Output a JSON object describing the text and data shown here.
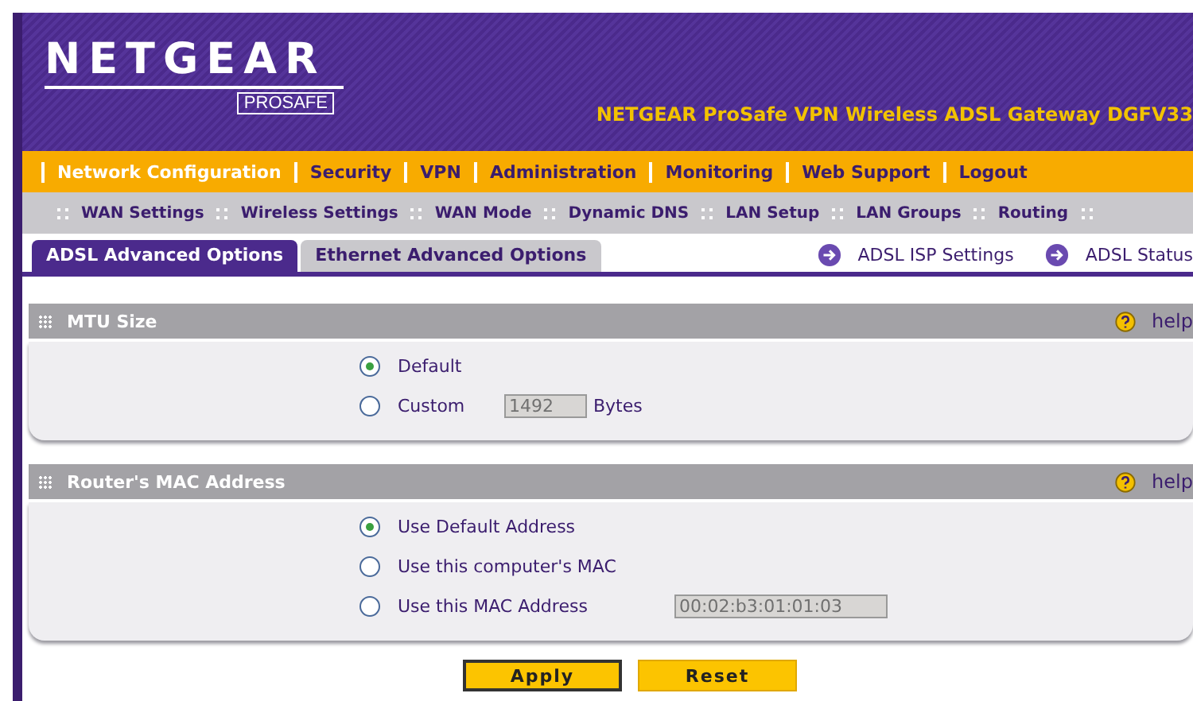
{
  "logo": {
    "brand": "NETGEAR",
    "sub": "PROSAFE"
  },
  "product_title": "NETGEAR ProSafe VPN Wireless ADSL Gateway DGFV33",
  "main_menu": [
    {
      "label": "Network Configuration",
      "selected": true
    },
    {
      "label": "Security",
      "selected": false
    },
    {
      "label": "VPN",
      "selected": false
    },
    {
      "label": "Administration",
      "selected": false
    },
    {
      "label": "Monitoring",
      "selected": false
    },
    {
      "label": "Web Support",
      "selected": false
    },
    {
      "label": "Logout",
      "selected": false
    }
  ],
  "sub_menu": [
    "WAN Settings",
    "Wireless Settings",
    "WAN Mode",
    "Dynamic DNS",
    "LAN Setup",
    "LAN Groups",
    "Routing"
  ],
  "tabs": [
    {
      "label": "ADSL Advanced Options",
      "selected": true
    },
    {
      "label": "Ethernet Advanced Options",
      "selected": false
    }
  ],
  "links": [
    "ADSL ISP Settings",
    "ADSL Status"
  ],
  "sections": [
    {
      "title": "MTU Size",
      "help": "help",
      "options": [
        {
          "label": "Default",
          "selected": true
        },
        {
          "label": "Custom",
          "selected": false,
          "field": {
            "value": "1492",
            "disabled": true
          },
          "unit": "Bytes"
        }
      ]
    },
    {
      "title": "Router's MAC Address",
      "help": "help",
      "options": [
        {
          "label": "Use Default Address",
          "selected": true
        },
        {
          "label": "Use this computer's MAC",
          "selected": false
        },
        {
          "label": "Use this MAC Address",
          "selected": false,
          "field": {
            "value": "00:02:b3:01:01:03",
            "disabled": true
          }
        }
      ]
    }
  ],
  "buttons": [
    "Apply",
    "Reset"
  ]
}
